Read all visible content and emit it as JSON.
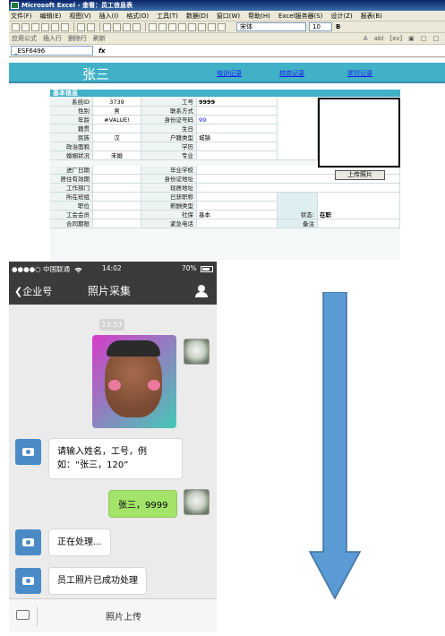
{
  "excel": {
    "title": "Microsoft Excel - 查看：员工信息表",
    "menu": [
      "文件(F)",
      "编辑(E)",
      "视图(V)",
      "插入(I)",
      "格式(O)",
      "工具(T)",
      "数据(D)",
      "窗口(W)",
      "帮助(H)",
      "Excel服务器(S)",
      "设计(Z)",
      "报表(B)"
    ],
    "font_name": "宋体",
    "font_size": "10",
    "bold_label": "B",
    "toolbar2": [
      "应用公式",
      "插入行",
      "删除行",
      "刷新"
    ],
    "toolbar2_right": [
      "A",
      "abl",
      "[xv]",
      "▣",
      "□",
      "□"
    ],
    "name_box": "_ESF6496",
    "fx": "fx",
    "employee_name": "张三",
    "header_links": [
      "培训记录",
      "转岗记录",
      "奖罚记录"
    ],
    "panel_title": "基本信息",
    "upload_button": "上传照片",
    "fields": {
      "staff_id_label": "系统ID",
      "staff_id": "3739",
      "job_no_label": "工号",
      "job_no": "9999",
      "gender_label": "性别",
      "gender": "男",
      "contact_label": "联系方式",
      "age_label": "年龄",
      "age": "#VALUE!",
      "idcard_label": "身份证号码",
      "idcard": "99",
      "native_label": "籍贯",
      "birthday_label": "生日",
      "ethnic_label": "民族",
      "ethnic": "汉",
      "hukou_label": "户籍类型",
      "hukou": "城镇",
      "politics_label": "政治面貌",
      "education_label": "学历",
      "marital_label": "婚姻状况",
      "marital": "未婚",
      "major_label": "专业",
      "join_date_label": "进厂日期",
      "school_label": "毕业学校",
      "residence_label": "居住有效期",
      "id_address_label": "身份证地址",
      "department_label": "工作部门",
      "current_address_label": "现居地址",
      "team_label": "所在班组",
      "title_label": "已获职称",
      "position_label": "职位",
      "salary_label": "薪酬类型",
      "union_label": "工会会员",
      "insurance_label": "社保",
      "insurance": "基本",
      "status_label": "状态:",
      "status": "在职",
      "contract_label": "合同期限",
      "emergency_label": "紧急电话",
      "note_label": "备注"
    }
  },
  "phone": {
    "carrier": "●●●●○ 中国联通",
    "wifi_icon": "wifi",
    "time": "14:02",
    "battery": "70%",
    "back_label": "企业号",
    "title": "照片采集",
    "timestamp": "13:53",
    "messages": [
      {
        "from": "user",
        "type": "photo"
      },
      {
        "from": "bot",
        "text": "请输入姓名，工号，例如：“张三，120”"
      },
      {
        "from": "user",
        "text": "张三，9999"
      },
      {
        "from": "bot",
        "text": "正在处理..."
      },
      {
        "from": "bot",
        "text": "员工照片已成功处理"
      }
    ],
    "bottom_label": "照片上传"
  },
  "arrow": {
    "color": "#5b9bd5",
    "direction": "down"
  }
}
